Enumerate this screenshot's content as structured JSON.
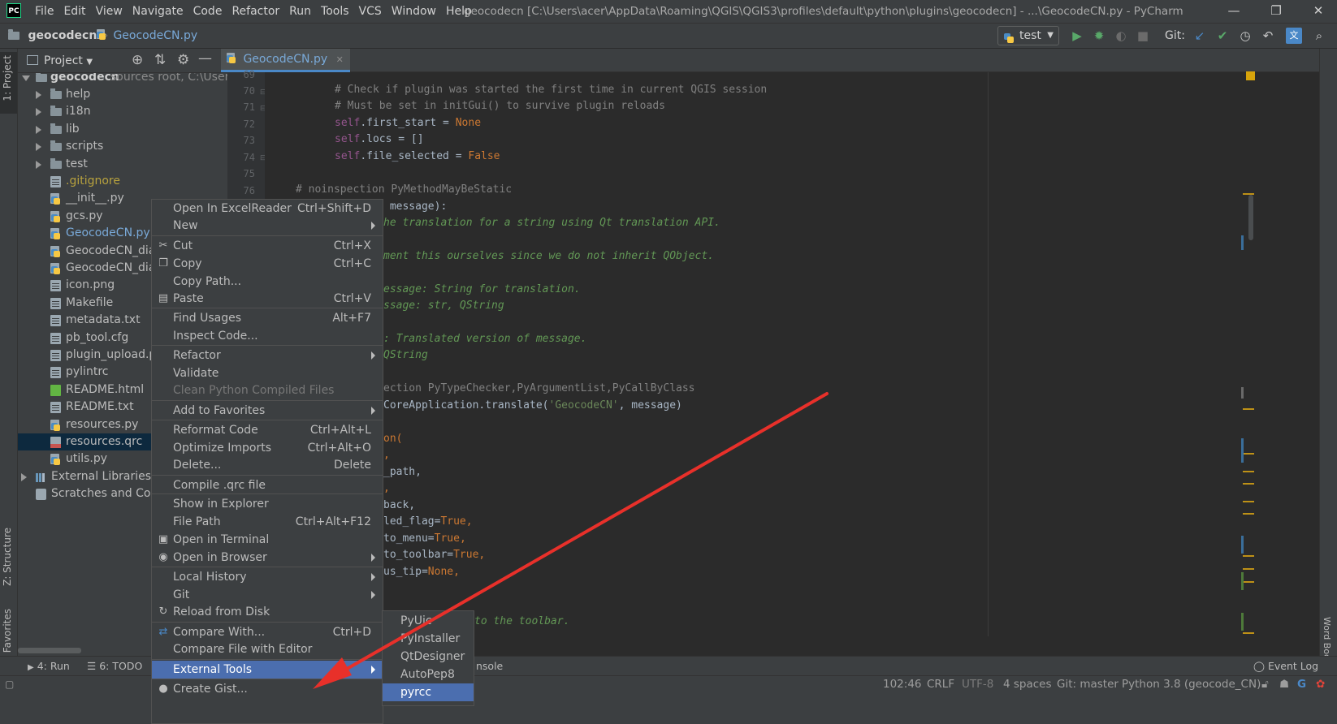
{
  "window": {
    "logo": "PC",
    "menu": [
      "File",
      "Edit",
      "View",
      "Navigate",
      "Code",
      "Refactor",
      "Run",
      "Tools",
      "VCS",
      "Window",
      "Help"
    ],
    "title": "geocodecn [C:\\Users\\acer\\AppData\\Roaming\\QGIS\\QGIS3\\profiles\\default\\python\\plugins\\geocodecn] - ...\\GeocodeCN.py - PyCharm",
    "controls": {
      "minimize": "—",
      "maximize": "❐",
      "close": "✕"
    }
  },
  "navbar": {
    "project": "geocodecn",
    "file": "GeocodeCN.py",
    "run_config": "test",
    "git_label": "Git:"
  },
  "left_stripe": {
    "project_tab": "1: Project",
    "structure_tab": "Z: Structure",
    "favorites_tab": "2: Favorites"
  },
  "right_stripe": {
    "wordbook_tab": "Word Book"
  },
  "project_panel": {
    "title": "Project",
    "root": {
      "name": "geocodecn",
      "note": "sources root, C:\\User"
    },
    "items": [
      {
        "label": "help",
        "type": "folder"
      },
      {
        "label": "i18n",
        "type": "folder"
      },
      {
        "label": "lib",
        "type": "folder"
      },
      {
        "label": "scripts",
        "type": "folder"
      },
      {
        "label": "test",
        "type": "folder"
      },
      {
        "label": ".gitignore",
        "type": "doc"
      },
      {
        "label": "__init__.py",
        "type": "py"
      },
      {
        "label": "gcs.py",
        "type": "py"
      },
      {
        "label": "GeocodeCN.py",
        "type": "py"
      },
      {
        "label": "GeocodeCN_dia",
        "type": "py"
      },
      {
        "label": "GeocodeCN_dia",
        "type": "py"
      },
      {
        "label": "icon.png",
        "type": "doc"
      },
      {
        "label": "Makefile",
        "type": "doc"
      },
      {
        "label": "metadata.txt",
        "type": "doc"
      },
      {
        "label": "pb_tool.cfg",
        "type": "doc"
      },
      {
        "label": "plugin_upload.p",
        "type": "doc"
      },
      {
        "label": "pylintrc",
        "type": "doc"
      },
      {
        "label": "README.html",
        "type": "html"
      },
      {
        "label": "README.txt",
        "type": "doc"
      },
      {
        "label": "resources.py",
        "type": "py"
      },
      {
        "label": "resources.qrc",
        "type": "qrc"
      },
      {
        "label": "utils.py",
        "type": "py"
      },
      {
        "label": "External Libraries",
        "type": "lib"
      },
      {
        "label": "Scratches and Cons",
        "type": "scr"
      }
    ]
  },
  "editor": {
    "tab": "GeocodeCN.py",
    "line_numbers": [
      "69",
      "70",
      "71",
      "72",
      "73",
      "74",
      "75",
      "76"
    ],
    "lines": {
      "l70": "# Check if plugin was started the first time in current QGIS session",
      "l71": "# Must be set in initGui() to survive plugin reloads",
      "l72a": "self",
      "l72b": ".first_start = ",
      "l72c": "None",
      "l73a": "self",
      "l73b": ".locs = []",
      "l74a": "self",
      "l74b": ".file_selected = ",
      "l74c": "False",
      "l76": "# noinspection PyMethodMayBeStatic",
      "v1": " message):",
      "v2": "he translation for a string using Qt translation API.",
      "v3": "ment this ourselves since we do not inherit QObject.",
      "v4": "essage: String for translation.",
      "v5": "ssage: str, QString",
      "v6": ": Translated version of message.",
      "v7": "QString",
      "v8": "ection PyTypeChecker,PyArgumentList,PyCallByClass",
      "v9a": "CoreApplication.translate(",
      "v9b": "'GeocodeCN'",
      "v9c": ", message)",
      "v10": "on(",
      "v11": ",",
      "v12": "_path,",
      "v13": ",",
      "v14": "back,",
      "v15a": "led_flag=",
      "v15b": "True",
      "v15c": ",",
      "v16a": "to_menu=",
      "v16b": "True",
      "v16c": ",",
      "v17a": "to_toolbar=",
      "v17b": "True",
      "v17c": ",",
      "v18a": "us_tip=",
      "v18b": "None",
      "v18c": ",",
      "v19": "to the toolbar."
    }
  },
  "context_menu": {
    "items": [
      {
        "label": "Open In ExcelReader",
        "shortcut": "Ctrl+Shift+D"
      },
      {
        "label": "New",
        "submenu": true
      },
      {
        "label": "Cut",
        "shortcut": "Ctrl+X",
        "icon": "✂"
      },
      {
        "label": "Copy",
        "shortcut": "Ctrl+C",
        "icon": "❐"
      },
      {
        "label": "Copy Path..."
      },
      {
        "label": "Paste",
        "shortcut": "Ctrl+V",
        "icon": "▤"
      },
      {
        "label": "Find Usages",
        "shortcut": "Alt+F7"
      },
      {
        "label": "Inspect Code..."
      },
      {
        "label": "Refactor",
        "submenu": true
      },
      {
        "label": "Validate"
      },
      {
        "label": "Clean Python Compiled Files",
        "disabled": true
      },
      {
        "label": "Add to Favorites",
        "submenu": true
      },
      {
        "label": "Reformat Code",
        "shortcut": "Ctrl+Alt+L"
      },
      {
        "label": "Optimize Imports",
        "shortcut": "Ctrl+Alt+O"
      },
      {
        "label": "Delete...",
        "shortcut": "Delete"
      },
      {
        "label": "Compile .qrc file"
      },
      {
        "label": "Show in Explorer"
      },
      {
        "label": "File Path",
        "shortcut": "Ctrl+Alt+F12"
      },
      {
        "label": "Open in Terminal",
        "icon": "▣"
      },
      {
        "label": "Open in Browser",
        "submenu": true,
        "icon": "◉"
      },
      {
        "label": "Local History",
        "submenu": true
      },
      {
        "label": "Git",
        "submenu": true
      },
      {
        "label": "Reload from Disk",
        "icon": "↻"
      },
      {
        "label": "Compare With...",
        "shortcut": "Ctrl+D",
        "icon": "⇄"
      },
      {
        "label": "Compare File with Editor"
      },
      {
        "label": "External Tools",
        "submenu": true,
        "highlighted": true
      },
      {
        "label": "Create Gist...",
        "icon": "●"
      }
    ]
  },
  "submenu": {
    "items": [
      "PyUic",
      "PyInstaller",
      "QtDesigner",
      "AutoPep8",
      "pyrcc"
    ],
    "selected": "pyrcc"
  },
  "toolwindows": {
    "run": "4: Run",
    "todo": "6: TODO",
    "console": "nsole",
    "event_log": "Event Log"
  },
  "status": {
    "position": "102:46",
    "line_sep": "CRLF",
    "encoding": "UTF-8",
    "indent": "4 spaces",
    "git": "Git: master",
    "interpreter": "Python 3.8 (geocode_CN)"
  },
  "colors": {
    "annotation_arrow": "#e8302a",
    "selection": "#4b6eaf",
    "accent": "#4a88c7"
  }
}
